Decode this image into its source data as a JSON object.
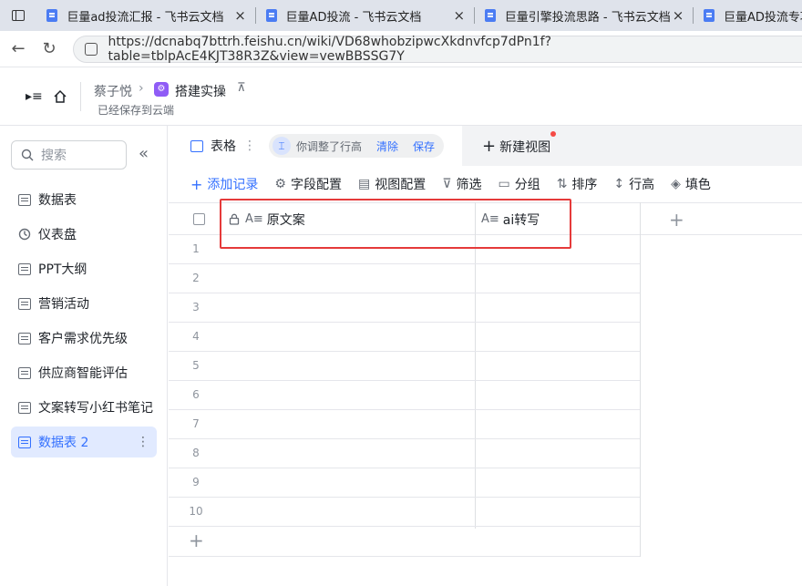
{
  "browser": {
    "tabs": [
      {
        "title": "巨量ad投流汇报 - 飞书云文档",
        "close": "×"
      },
      {
        "title": "巨量AD投流 - 飞书云文档",
        "close": "×"
      },
      {
        "title": "巨量引擎投流思路 - 飞书云文档",
        "close": "×"
      },
      {
        "title": "巨量AD投流专项",
        "close": ""
      }
    ],
    "url": "https://dcnabq7bttrh.feishu.cn/wiki/VD68whobzipwcXkdnvfcp7dPn1f?table=tblpAcE4KJT38R3Z&view=vewBBSSG7Y"
  },
  "doc_header": {
    "breadcrumb_parent": "蔡子悦",
    "separator": "›",
    "title": "搭建实操",
    "save_status": "已经保存到云端"
  },
  "sidebar": {
    "search_placeholder": "搜索",
    "collapse": "«",
    "items": [
      {
        "label": "数据表",
        "icon": "table-icon"
      },
      {
        "label": "仪表盘",
        "icon": "dashboard-icon"
      },
      {
        "label": "PPT大纲",
        "icon": "table-icon"
      },
      {
        "label": "营销活动",
        "icon": "table-icon"
      },
      {
        "label": "客户需求优先级",
        "icon": "table-icon"
      },
      {
        "label": "供应商智能评估",
        "icon": "table-icon"
      },
      {
        "label": "文案转写小红书笔记",
        "icon": "table-icon"
      },
      {
        "label": "数据表 2",
        "icon": "table-icon",
        "active": true,
        "more": "⋮"
      }
    ]
  },
  "view": {
    "tab_label": "表格",
    "notice": "你调整了行高",
    "clear_label": "清除",
    "save_label": "保存",
    "new_view_label": "新建视图",
    "new_view_plus": "+"
  },
  "toolbar": {
    "add_record": "添加记录",
    "field_config": "字段配置",
    "view_config": "视图配置",
    "filter": "筛选",
    "group": "分组",
    "sort": "排序",
    "row_height": "行高",
    "fill_color": "填色"
  },
  "table": {
    "columns": [
      {
        "label": "原文案",
        "locked": true
      },
      {
        "label": "ai转写",
        "locked": false
      }
    ],
    "add_column": "+",
    "add_row": "+",
    "rows": [
      "1",
      "2",
      "3",
      "4",
      "5",
      "6",
      "7",
      "8",
      "9",
      "10"
    ]
  },
  "colors": {
    "accent": "#3370ff",
    "highlight_box": "#e53a3a",
    "tab_bar": "#dfe3eb"
  }
}
